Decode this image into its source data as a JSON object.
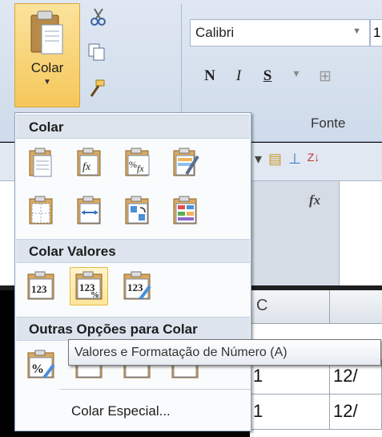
{
  "ribbon": {
    "paste_label": "Colar",
    "font_name": "Calibri",
    "font_size": "1",
    "bold": "N",
    "italic": "I",
    "underline": "S",
    "group_font_label": "Fonte"
  },
  "menu": {
    "section_paste": "Colar",
    "section_values": "Colar Valores",
    "section_other": "Outras Opções para Colar",
    "paste_special": "Colar Especial...",
    "value_icon_text": "123"
  },
  "tooltip": {
    "text": "Valores e Formatação de Número (A)"
  },
  "sheet": {
    "formula_icon": "fx",
    "column_c": "C",
    "rows": [
      {
        "c": "1",
        "d": "12/"
      },
      {
        "c": "1",
        "d": "12/"
      }
    ]
  },
  "colors": {
    "hover_fill": "#fde59a",
    "menu_header": "#dde4ee",
    "ribbon_bg": "#dfe7f2"
  }
}
